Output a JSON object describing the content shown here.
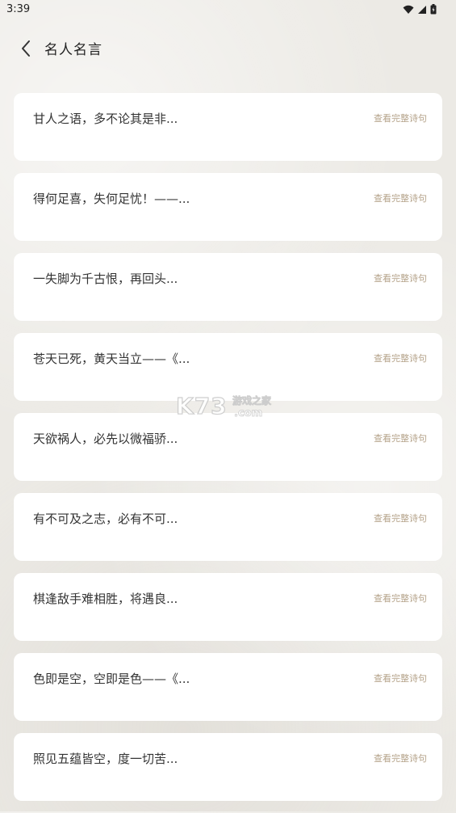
{
  "status": {
    "time": "3:39"
  },
  "header": {
    "title": "名人名言"
  },
  "quotes": [
    {
      "text": "甘人之语，多不论其是非...",
      "link": "查看完整诗句"
    },
    {
      "text": "得何足喜，失何足忧！——...",
      "link": "查看完整诗句"
    },
    {
      "text": "一失脚为千古恨，再回头...",
      "link": "查看完整诗句"
    },
    {
      "text": "苍天已死，黄天当立——《...",
      "link": "查看完整诗句"
    },
    {
      "text": "天欲祸人，必先以微福骄...",
      "link": "查看完整诗句"
    },
    {
      "text": "有不可及之志，必有不可...",
      "link": "查看完整诗句"
    },
    {
      "text": "棋逢敌手难相胜，将遇良...",
      "link": "查看完整诗句"
    },
    {
      "text": "色即是空，空即是色——《...",
      "link": "查看完整诗句"
    },
    {
      "text": "照见五蕴皆空，度一切苦...",
      "link": "查看完整诗句"
    }
  ],
  "watermark": {
    "brand": "K73",
    "cn": "游戏之家",
    "domain": ".com"
  },
  "colors": {
    "background": "#eceae5",
    "card": "#ffffff",
    "link": "#b5a38a",
    "text": "#333333"
  }
}
